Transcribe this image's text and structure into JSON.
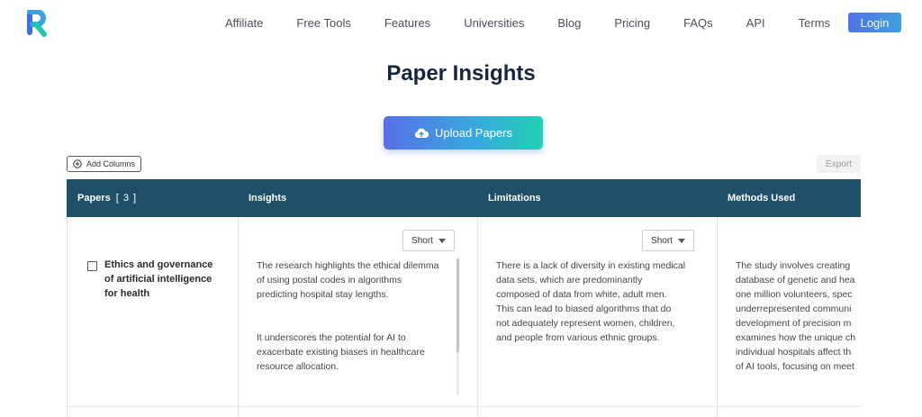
{
  "nav": {
    "items": [
      "Affiliate",
      "Free Tools",
      "Features",
      "Universities",
      "Blog",
      "Pricing",
      "FAQs",
      "API",
      "Terms"
    ],
    "login_label": "Login"
  },
  "page": {
    "title": "Paper Insights",
    "upload_label": "Upload Papers",
    "add_columns_label": "Add Columns",
    "export_label": "Export"
  },
  "table": {
    "headers": {
      "papers": "Papers",
      "papers_count": "[ 3 ]",
      "insights": "Insights",
      "limitations": "Limitations",
      "methods": "Methods Used"
    },
    "row": {
      "title_lines": [
        "Ethics and governance",
        "of artificial intelligence",
        "for health"
      ],
      "insights_short_label": "Short",
      "limitations_short_label": "Short",
      "insights_lines": [
        "The research highlights the ethical dilemma",
        "of using postal codes in algorithms",
        "predicting hospital stay lengths.",
        "It underscores the potential for AI to",
        "exacerbate existing biases in healthcare",
        "resource allocation."
      ],
      "limitations_lines": [
        "There is a lack of diversity in existing medical",
        "data sets, which are predominantly",
        "composed of data from white, adult men.",
        "This can lead to biased algorithms that do",
        "not adequately represent women, children,",
        "and people from various ethnic groups."
      ],
      "methods_lines": [
        "The study involves creating",
        "database of genetic and hea",
        "one million volunteers, spec",
        "underrepresented communi",
        "development of precision m",
        "examines how the unique ch",
        "individual hospitals affect th",
        "of AI tools, focusing on meet"
      ]
    }
  },
  "colors": {
    "header_bg": "#1f5068",
    "title": "#16263e",
    "login": "#4f72e6",
    "logo_blue": "#3d6fe0",
    "logo_teal": "#22c7b0"
  }
}
